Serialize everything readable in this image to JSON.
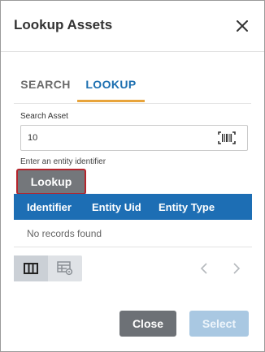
{
  "dialog": {
    "title": "Lookup Assets"
  },
  "tabs": [
    {
      "label": "SEARCH",
      "active": false
    },
    {
      "label": "LOOKUP",
      "active": true
    }
  ],
  "form": {
    "field_label": "Search Asset",
    "value": "10",
    "helper_text": "Enter an entity identifier",
    "lookup_label": "Lookup"
  },
  "table": {
    "columns": [
      "Identifier",
      "Entity Uid",
      "Entity Type"
    ],
    "empty_message": "No records found"
  },
  "icons": {
    "close": "close-icon",
    "barcode": "barcode-scan-icon",
    "grid_view": "column-view-icon",
    "table_settings": "table-settings-icon",
    "prev": "chevron-left-icon",
    "next": "chevron-right-icon"
  },
  "footer": {
    "close_label": "Close",
    "select_label": "Select"
  },
  "colors": {
    "accent": "#1d6eb4",
    "tab_underline": "#e8a43b",
    "focus_outline": "#b5242c"
  }
}
